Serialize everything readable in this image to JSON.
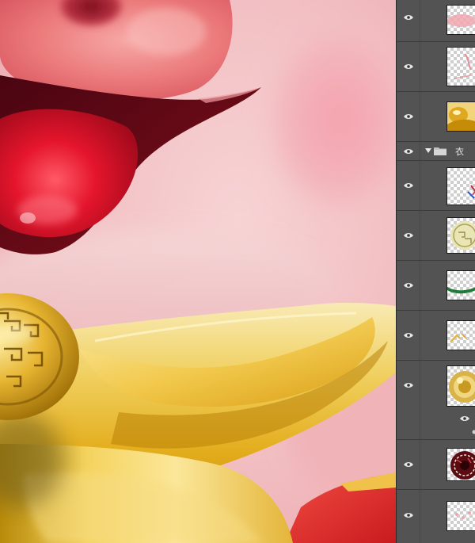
{
  "window": {
    "canvas_description_color": "#f3c9cb",
    "panel_bg": "#535353"
  },
  "layers_panel": {
    "group_label": "衣",
    "layers": [
      {
        "id": "layer-1",
        "visible": true,
        "thumb": "pink-blur"
      },
      {
        "id": "layer-2",
        "visible": true,
        "thumb": "transparent-sparse"
      },
      {
        "id": "layer-3",
        "visible": true,
        "thumb": "gold-ingot"
      },
      {
        "id": "layer-4",
        "visible": true,
        "thumb": "ribbon-strokes"
      },
      {
        "id": "layer-5",
        "visible": true,
        "thumb": "jade-medallion"
      },
      {
        "id": "layer-6",
        "visible": true,
        "thumb": "green-band"
      },
      {
        "id": "layer-7",
        "visible": true,
        "thumb": "gold-flecks"
      },
      {
        "id": "layer-8",
        "visible": true,
        "thumb": "gold-coin"
      },
      {
        "id": "layer-9",
        "visible": true,
        "thumb": "dark-red-coin"
      },
      {
        "id": "layer-10",
        "visible": true,
        "thumb": "pink-dots"
      }
    ],
    "icons": {
      "eye": "eye-icon",
      "folder": "folder-icon",
      "disclosure": "triangle-down-icon"
    }
  }
}
